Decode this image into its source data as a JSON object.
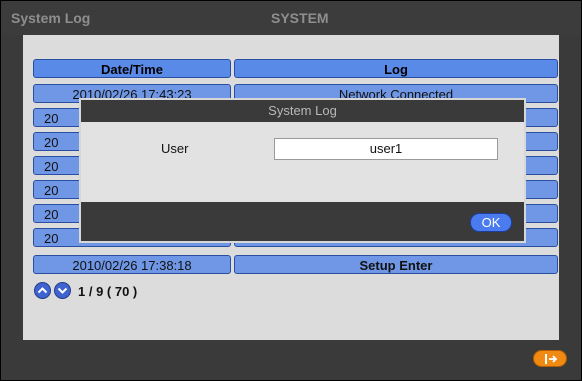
{
  "window": {
    "title_left": "System Log",
    "title_center": "SYSTEM"
  },
  "table": {
    "headers": {
      "datetime": "Date/Time",
      "log": "Log"
    },
    "rows": [
      {
        "datetime": "2010/02/26  17:43:23",
        "log": "Network Connected"
      },
      {
        "datetime": "20",
        "log": ""
      },
      {
        "datetime": "20",
        "log": ""
      },
      {
        "datetime": "20",
        "log": ""
      },
      {
        "datetime": "20",
        "log": ""
      },
      {
        "datetime": "20",
        "log": ""
      },
      {
        "datetime": "20",
        "log": ""
      },
      {
        "datetime": "2010/02/26  17:38:18",
        "log": "Setup Enter"
      }
    ]
  },
  "pager": {
    "text": "1 / 9 ( 70 )"
  },
  "dialog": {
    "title": "System Log",
    "user_label": "User",
    "user_value": "user1",
    "ok_label": "OK"
  },
  "icons": {
    "prev": "chevron-up-icon",
    "next": "chevron-down-icon",
    "exit": "exit-icon"
  },
  "colors": {
    "cell_blue": "#6f97e6",
    "header_blue": "#5a8ae8",
    "exit_orange": "#f08a13",
    "button_blue": "#4a7cf0"
  }
}
